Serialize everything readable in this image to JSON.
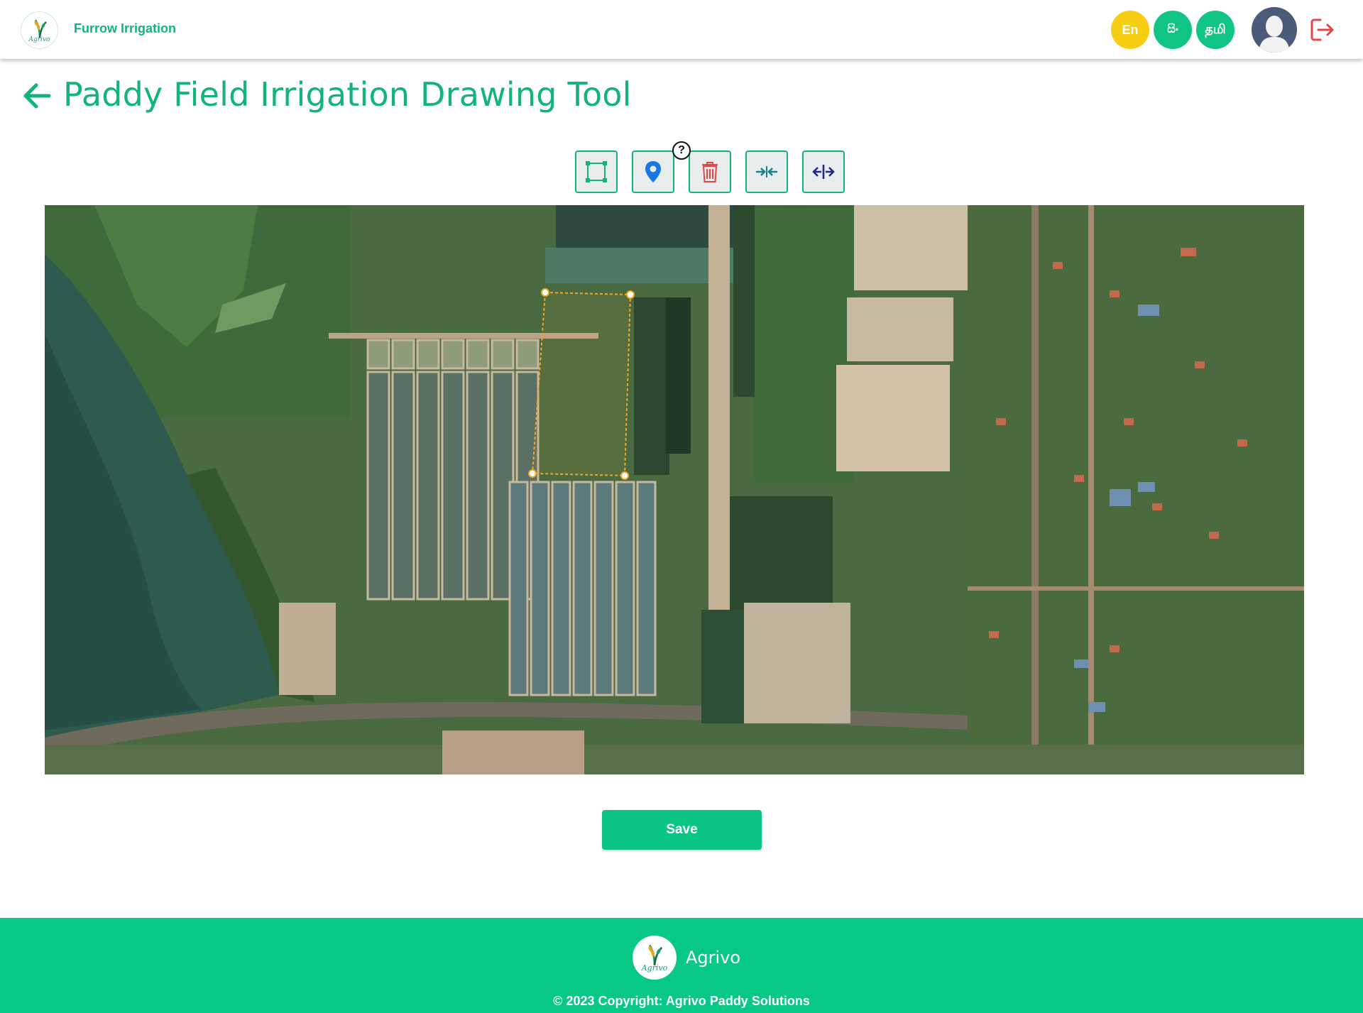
{
  "header": {
    "logo_text": "Agrivo",
    "app_name": "Furrow Irrigation",
    "languages": [
      {
        "label": "En",
        "color": "#f7cd12"
      },
      {
        "label": "සිං",
        "color": "#10c483"
      },
      {
        "label": "தமி",
        "color": "#10c483"
      }
    ]
  },
  "page": {
    "title": "Paddy Field Irrigation Drawing Tool"
  },
  "toolbar": {
    "help_label": "?",
    "tools": [
      {
        "name": "rectangle-tool",
        "icon": "rectangle-select-icon"
      },
      {
        "name": "marker-tool",
        "icon": "map-pin-icon"
      },
      {
        "name": "delete-tool",
        "icon": "trash-icon"
      },
      {
        "name": "merge-tool",
        "icon": "arrows-inward-icon"
      },
      {
        "name": "split-tool",
        "icon": "arrows-outward-icon"
      }
    ]
  },
  "map": {
    "selection_color": "#f5a623"
  },
  "actions": {
    "save_label": "Save"
  },
  "footer": {
    "logo_text": "Agrivo",
    "brand": "Agrivo",
    "copyright": "© 2023 Copyright: Agrivo Paddy Solutions"
  },
  "colors": {
    "brand_green": "#12b37c",
    "footer_green": "#08c885",
    "accent_yellow": "#f7cd12",
    "logout_red": "#e64545"
  }
}
